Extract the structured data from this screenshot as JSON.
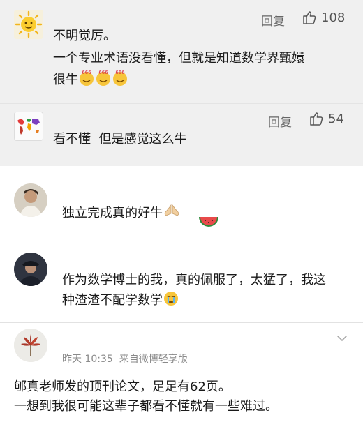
{
  "reply_1": {
    "line1": "不明觉厉。",
    "line2": "一个专业术语没看懂，但就是知道数学界甄嬛",
    "line3": "很牛",
    "reply_label": "回复",
    "like_count": "108"
  },
  "reply_2": {
    "text": "看不懂  但是感觉这么牛",
    "reply_label": "回复",
    "like_count": "54"
  },
  "comment_1": {
    "text": "独立完成真的好牛"
  },
  "comment_2": {
    "line1": "作为数学博士的我，真的佩服了，太猛了，我这",
    "line2": "种渣渣不配学数学"
  },
  "post": {
    "meta": "昨天 10:35  来自微博轻享版",
    "line1": "郇真老师发的顶刊论文，足足有62页。",
    "line2": "一想到我很可能这辈子都看不懂就有一些难过。"
  },
  "icons": {
    "like": "thumbs-up-icon",
    "expand": "chevron-down-icon",
    "emoji_666": "666-emoji-icon",
    "emoji_pray": "pray-emoji-icon",
    "emoji_watermelon": "watermelon-emoji-icon",
    "emoji_cry": "crying-emoji-icon"
  },
  "colors": {
    "reply_block_bg": "#f0f0f0",
    "meta_text": "#8a8a8a",
    "action_text": "#666666"
  }
}
